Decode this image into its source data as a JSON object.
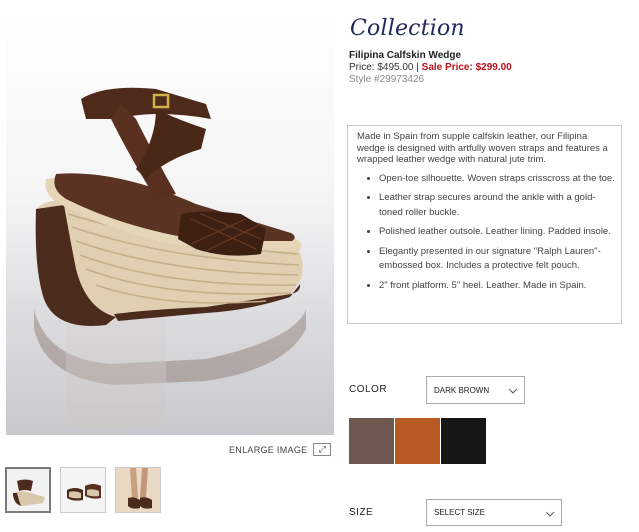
{
  "page": {
    "title": "Collection",
    "product_name": "Filipina Calfskin Wedge",
    "price_label": "Price: $495.00",
    "separator": "|",
    "sale_label": "Sale Price: $299.00",
    "style_label": "Style #29973426"
  },
  "gallery": {
    "enlarge_label": "ENLARGE IMAGE",
    "enlarge_icon": "expand-icon",
    "thumbnail_count": 3
  },
  "description": {
    "intro": "Made in Spain from supple calfskin leather, our Filipina wedge is designed with artfully woven straps and features a wrapped leather wedge with natural jute trim.",
    "bullets": [
      "Open-toe silhouette. Woven straps crisscross at the toe.",
      "Leather strap secures around the ankle with a gold-toned roller buckle.",
      "Polished leather outsole. Leather lining. Padded insole.",
      "Elegantly presented in our signature \"Ralph Lauren\"-embossed box. Includes a protective felt pouch.",
      "2\" front platform. 5\" heel. Leather. Made in Spain."
    ]
  },
  "options": {
    "color_label": "COLOR",
    "color_selected": "DARK BROWN",
    "size_label": "SIZE",
    "size_placeholder": "SELECT SIZE"
  },
  "swatches": [
    {
      "name": "swatch-taupe",
      "color": "#6e5850"
    },
    {
      "name": "swatch-tan",
      "color": "#b85a22"
    },
    {
      "name": "swatch-black",
      "color": "#161616"
    }
  ],
  "colors": {
    "title": "#22285e",
    "sale": "#b8101a",
    "border": "#c9c9c9"
  }
}
